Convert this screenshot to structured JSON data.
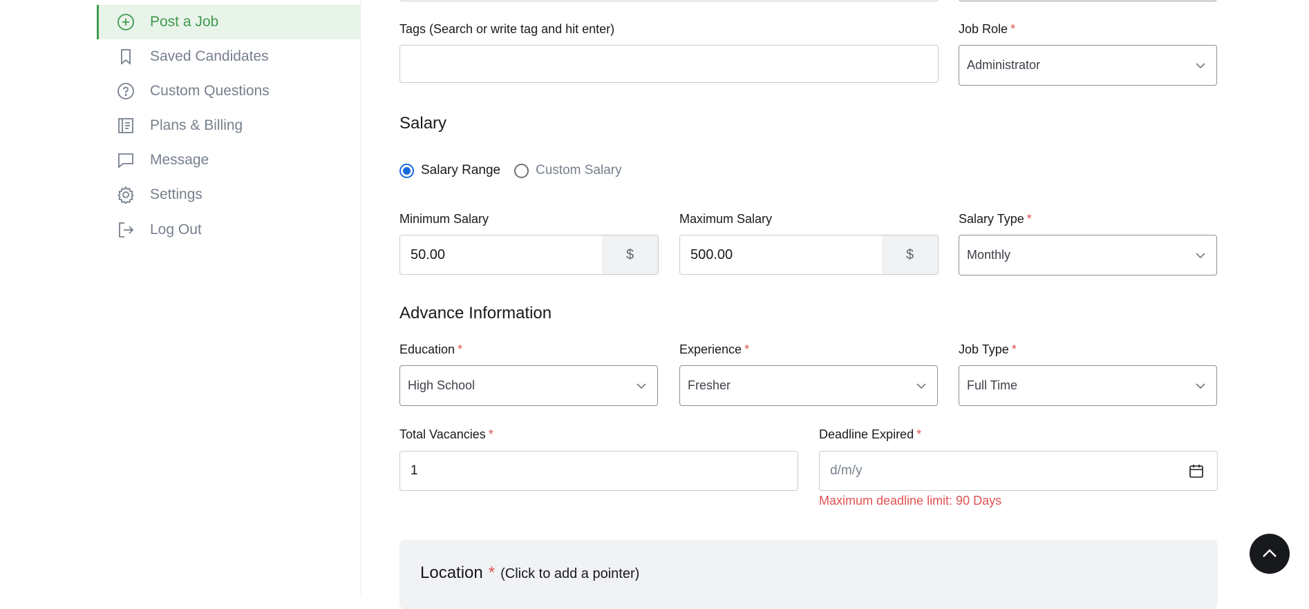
{
  "sidebar": {
    "items": [
      {
        "label": "Post a Job",
        "icon": "plus-circle-icon",
        "active": true
      },
      {
        "label": "Saved Candidates",
        "icon": "bookmark-icon"
      },
      {
        "label": "Custom Questions",
        "icon": "question-circle-icon"
      },
      {
        "label": "Plans & Billing",
        "icon": "billing-document-icon"
      },
      {
        "label": "Message",
        "icon": "message-icon"
      },
      {
        "label": "Settings",
        "icon": "gear-icon"
      },
      {
        "label": "Log Out",
        "icon": "logout-icon"
      }
    ]
  },
  "form": {
    "tags": {
      "label": "Tags (Search or write tag and hit enter)",
      "value": ""
    },
    "job_role": {
      "label": "Job Role",
      "required": "*",
      "value": "Administrator"
    },
    "salary": {
      "title": "Salary",
      "mode_options": [
        {
          "label": "Salary Range",
          "selected": true
        },
        {
          "label": "Custom Salary",
          "selected": false
        }
      ],
      "minimum": {
        "label": "Minimum Salary",
        "value": "50.00",
        "currency": "$"
      },
      "maximum": {
        "label": "Maximum Salary",
        "value": "500.00",
        "currency": "$"
      },
      "type": {
        "label": "Salary Type",
        "required": "*",
        "value": "Monthly"
      }
    },
    "advance": {
      "title": "Advance Information",
      "education": {
        "label": "Education",
        "required": "*",
        "value": "High School"
      },
      "experience": {
        "label": "Experience",
        "required": "*",
        "value": "Fresher"
      },
      "job_type": {
        "label": "Job Type",
        "required": "*",
        "value": "Full Time"
      },
      "vacancies": {
        "label": "Total Vacancies",
        "required": "*",
        "value": "1"
      },
      "deadline": {
        "label": "Deadline Expired",
        "required": "*",
        "placeholder": "d/m/y",
        "error": "Maximum deadline limit: 90 Days"
      }
    },
    "location": {
      "title": "Location",
      "required": "*",
      "hint": "(Click to add a pointer)"
    }
  },
  "colors": {
    "accent": "#3f9a4e",
    "error": "#e05151",
    "radio": "#1569e0"
  }
}
